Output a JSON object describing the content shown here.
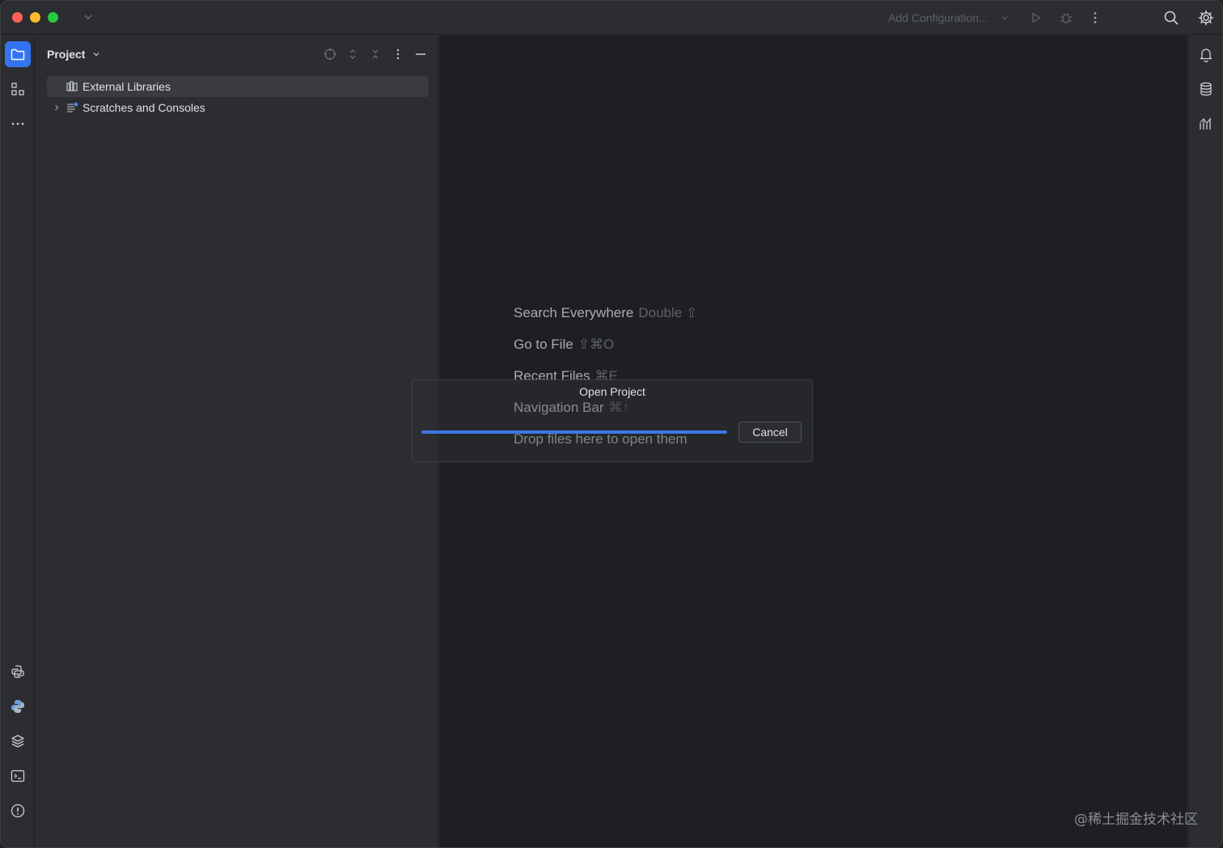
{
  "titlebar": {
    "add_configuration": "Add Configuration...",
    "icons": [
      "chevron-down-icon",
      "run-icon",
      "debug-icon",
      "more-icon",
      "search-icon",
      "settings-icon"
    ]
  },
  "project_panel": {
    "title": "Project",
    "tree": [
      {
        "label": "External Libraries",
        "icon": "library-icon",
        "selected": true,
        "expandable": false
      },
      {
        "label": "Scratches and Consoles",
        "icon": "scratches-icon",
        "selected": false,
        "expandable": true
      }
    ]
  },
  "editor_hints": [
    {
      "label": "Search Everywhere",
      "shortcut": "Double ⇧"
    },
    {
      "label": "Go to File",
      "shortcut": "⇧⌘O"
    },
    {
      "label": "Recent Files",
      "shortcut": "⌘E"
    },
    {
      "label": "Navigation Bar",
      "shortcut": "⌘↑"
    },
    {
      "label": "Drop files here to open them",
      "shortcut": ""
    }
  ],
  "dialog": {
    "title": "Open Project",
    "progress": 1.0,
    "cancel_label": "Cancel"
  },
  "watermark": "@稀土掘金技术社区",
  "colors": {
    "accent": "#3574f0",
    "progress": "#3b78e7",
    "panel_bg": "#2b2d30",
    "editor_bg": "#1e1f22"
  }
}
